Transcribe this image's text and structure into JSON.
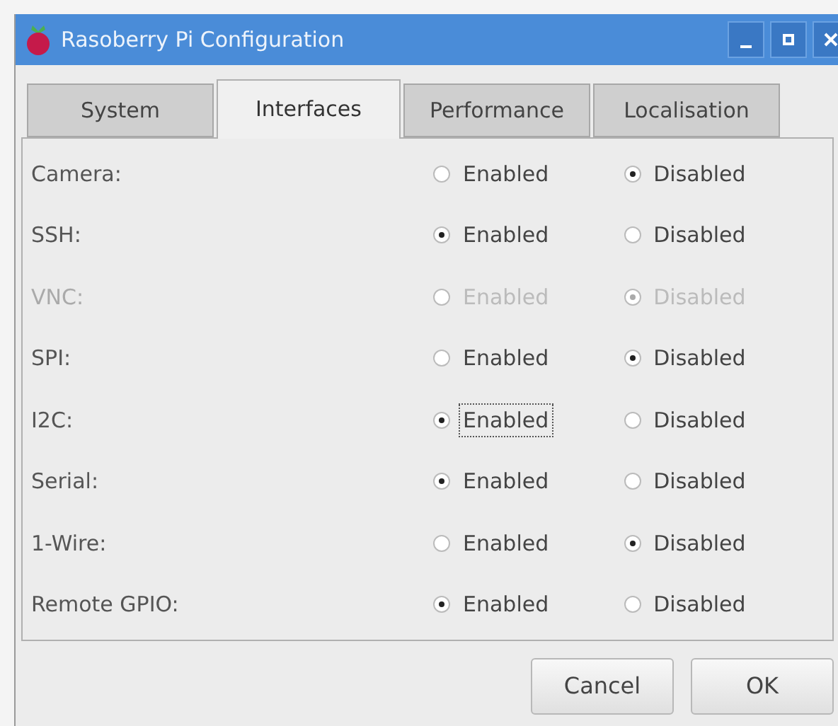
{
  "window": {
    "title": "Rasoberry Pi Configuration"
  },
  "tabs": [
    {
      "label": "System",
      "selected": false
    },
    {
      "label": "Interfaces",
      "selected": true
    },
    {
      "label": "Performance",
      "selected": false
    },
    {
      "label": "Localisation",
      "selected": false
    }
  ],
  "rows": [
    {
      "label": "Camera:",
      "disabled": false,
      "options": [
        {
          "label": "Enabled",
          "selected": false,
          "focused": false
        },
        {
          "label": "Disabled",
          "selected": true,
          "focused": false
        }
      ]
    },
    {
      "label": "SSH:",
      "disabled": false,
      "options": [
        {
          "label": "Enabled",
          "selected": true,
          "focused": false
        },
        {
          "label": "Disabled",
          "selected": false,
          "focused": false
        }
      ]
    },
    {
      "label": "VNC:",
      "disabled": true,
      "options": [
        {
          "label": "Enabled",
          "selected": false,
          "focused": false
        },
        {
          "label": "Disabled",
          "selected": true,
          "focused": false
        }
      ]
    },
    {
      "label": "SPI:",
      "disabled": false,
      "options": [
        {
          "label": "Enabled",
          "selected": false,
          "focused": false
        },
        {
          "label": "Disabled",
          "selected": true,
          "focused": false
        }
      ]
    },
    {
      "label": "I2C:",
      "disabled": false,
      "options": [
        {
          "label": "Enabled",
          "selected": true,
          "focused": true
        },
        {
          "label": "Disabled",
          "selected": false,
          "focused": false
        }
      ]
    },
    {
      "label": "Serial:",
      "disabled": false,
      "options": [
        {
          "label": "Enabled",
          "selected": true,
          "focused": false
        },
        {
          "label": "Disabled",
          "selected": false,
          "focused": false
        }
      ]
    },
    {
      "label": "1-Wire:",
      "disabled": false,
      "options": [
        {
          "label": "Enabled",
          "selected": false,
          "focused": false
        },
        {
          "label": "Disabled",
          "selected": true,
          "focused": false
        }
      ]
    },
    {
      "label": "Remote GPIO:",
      "disabled": false,
      "options": [
        {
          "label": "Enabled",
          "selected": true,
          "focused": false
        },
        {
          "label": "Disabled",
          "selected": false,
          "focused": false
        }
      ]
    }
  ],
  "buttons": [
    {
      "label": "Cancel"
    },
    {
      "label": "OK"
    }
  ]
}
